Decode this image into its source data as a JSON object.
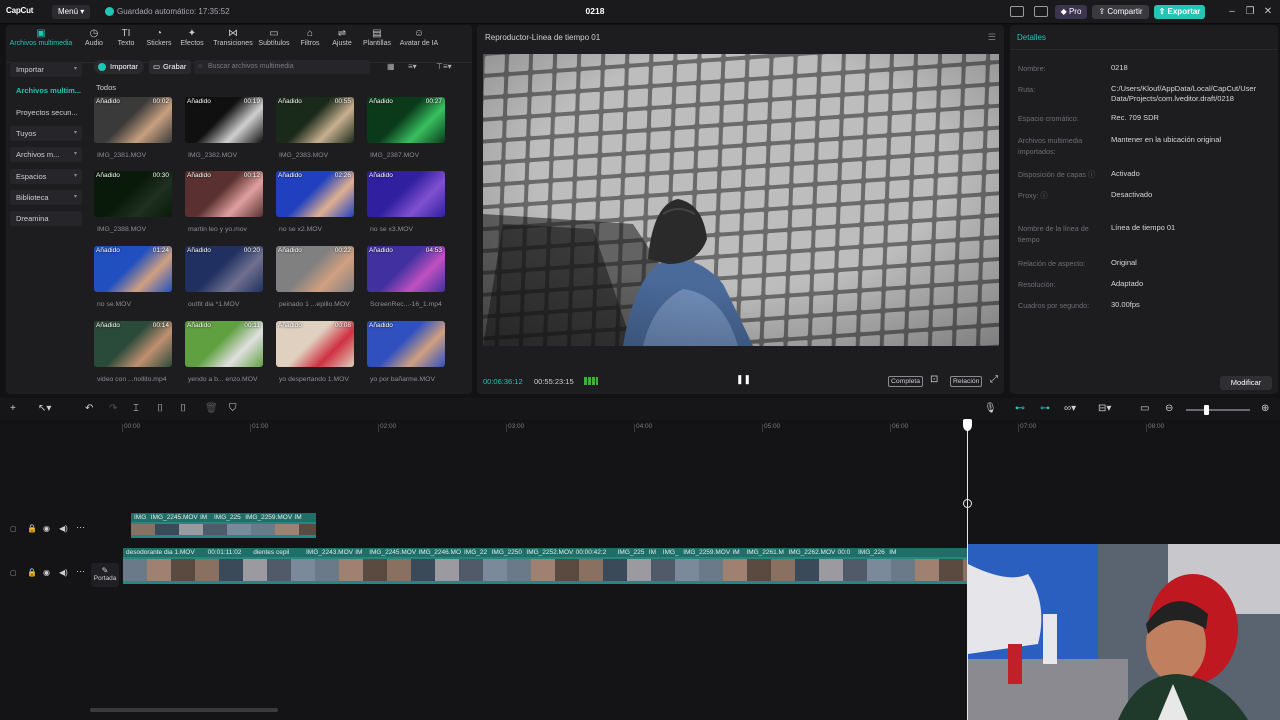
{
  "app": {
    "logo": "CapCut",
    "menu_label": "Menú",
    "autosave": "Guardado automático: 17:35:52",
    "project_title": "0218",
    "pro_label": "Pro",
    "share_label": "Compartir",
    "export_label": "Exportar",
    "accent_color": "#23c5b4"
  },
  "toolbar": {
    "items": [
      {
        "label": "Archivos multimedia",
        "icon": "media-icon"
      },
      {
        "label": "Audio",
        "icon": "audio-icon"
      },
      {
        "label": "Texto",
        "icon": "text-icon"
      },
      {
        "label": "Stickers",
        "icon": "sticker-icon"
      },
      {
        "label": "Efectos",
        "icon": "effects-icon"
      },
      {
        "label": "Transiciones",
        "icon": "transitions-icon"
      },
      {
        "label": "Subtítulos",
        "icon": "subtitles-icon"
      },
      {
        "label": "Filtros",
        "icon": "filters-icon"
      },
      {
        "label": "Ajuste",
        "icon": "adjust-icon"
      },
      {
        "label": "Plantillas",
        "icon": "templates-icon"
      },
      {
        "label": "Avatar de IA",
        "icon": "ai-avatar-icon"
      }
    ]
  },
  "sidebar": {
    "items": [
      {
        "label": "Importar"
      },
      {
        "label": "Archivos multim..."
      },
      {
        "label": "Proyectos secun..."
      },
      {
        "label": "Tuyos"
      },
      {
        "label": "Archivos m..."
      },
      {
        "label": "Espacios"
      },
      {
        "label": "Biblioteca"
      },
      {
        "label": "Dreamina"
      }
    ]
  },
  "media": {
    "import_label": "Importar",
    "record_label": "Grabar",
    "search_placeholder": "Buscar archivos multimedia",
    "all_label": "Todos",
    "added_label": "Añadido",
    "items": [
      {
        "name": "IMG_2381.MOV",
        "duration": "00:02"
      },
      {
        "name": "IMG_2382.MOV",
        "duration": "00:19"
      },
      {
        "name": "IMG_2383.MOV",
        "duration": "00:55"
      },
      {
        "name": "IMG_2387.MOV",
        "duration": "00:27"
      },
      {
        "name": "IMG_2388.MOV",
        "duration": "00:30"
      },
      {
        "name": "martin leo y yo.mov",
        "duration": "00:12"
      },
      {
        "name": "no se x2.MOV",
        "duration": "02:26"
      },
      {
        "name": "no se x3.MOV",
        "duration": ""
      },
      {
        "name": "no se.MOV",
        "duration": "01:24"
      },
      {
        "name": "outfit dia *1.MOV",
        "duration": "00:20"
      },
      {
        "name": "peinado 1 ...epillo.MOV",
        "duration": "00:22"
      },
      {
        "name": "ScreenRec...-16_1.mp4",
        "duration": "04:53"
      },
      {
        "name": "video con ...nollito.mp4",
        "duration": "00:14"
      },
      {
        "name": "yendo a b... enzo.MOV",
        "duration": "00:11"
      },
      {
        "name": "yo despertando 1.MOV",
        "duration": "00:08"
      },
      {
        "name": "yo por bañarme.MOV",
        "duration": ""
      }
    ]
  },
  "player": {
    "title": "Reproductor-Línea de tiempo 01",
    "current_time": "00:06:36:12",
    "total_time": "00:55:23:15",
    "full_label": "Completa",
    "ratio_label": "Relación"
  },
  "details": {
    "title": "Detalles",
    "rows": [
      {
        "label": "Nombre:",
        "value": "0218"
      },
      {
        "label": "Ruta:",
        "value": "C:/Users/Klouf/AppData/Local/CapCut/User Data/Projects/com.lveditor.draft/0218"
      },
      {
        "label": "Espacio cromático:",
        "value": "Rec. 709 SDR"
      },
      {
        "label": "Archivos multimedia importados:",
        "value": "Mantener en la ubicación original"
      },
      {
        "label": "Disposición de capas",
        "value": "Activado"
      },
      {
        "label": "Proxy:",
        "value": "Desactivado"
      },
      {
        "label": "Nombre de la línea de tiempo",
        "value": "Línea de tiempo 01"
      },
      {
        "label": "Relación de aspecto:",
        "value": "Original"
      },
      {
        "label": "Resolución:",
        "value": "Adaptado"
      },
      {
        "label": "Cuadros por segundo:",
        "value": "30.00fps"
      }
    ],
    "modify_label": "Modificar"
  },
  "timeline": {
    "ruler": [
      "00:00",
      "01:00",
      "02:00",
      "03:00",
      "04:00",
      "05:00",
      "06:00",
      "07:00",
      "08:00"
    ],
    "cover_label": "Portada",
    "upper_clips": [
      "IMG",
      "IMG_2245.MOV",
      "IM",
      "IMG_225",
      "IMG_2259.MOV",
      "IM"
    ],
    "main_clips": [
      "desodorante dia 1.MOV",
      "00:01:11:02",
      "dientes cepil",
      "IMG_2243.MOV",
      "IM",
      "IMG_2245.MOV",
      "IMG_2246.MO",
      "IMG_22",
      "IMG_2250",
      "IMG_2252.MOV",
      "00:00:42:2",
      "IMG_225",
      "IM",
      "IMG_",
      "IMG_2259.MOV",
      "IM",
      "IMG_2261.M",
      "IMG_2262.MOV",
      "00:0",
      "IMG_226",
      "IM"
    ]
  }
}
